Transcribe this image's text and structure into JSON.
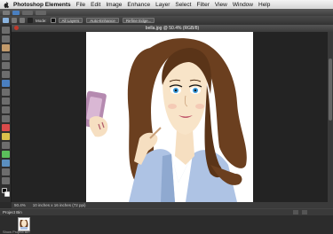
{
  "menubar": {
    "app_name": "Photoshop Elements",
    "items": [
      "File",
      "Edit",
      "Image",
      "Enhance",
      "Layer",
      "Select",
      "Filter",
      "View",
      "Window",
      "Help"
    ]
  },
  "options_bar": {
    "mode_label": "Mode:",
    "sample_label": "All Layers",
    "auto_enhance_label": "Auto-Enhance",
    "refine_edge_label": "Refine Edge..."
  },
  "document": {
    "tab_title": "bella.jpg @ 50.4% (RGB/8)",
    "zoom": "50.4%"
  },
  "status": {
    "zoom": "50.4%",
    "doc_info": "10 inches x 16 inches (72 ppi)"
  },
  "bin": {
    "title": "Project Bin",
    "footer": "Show Project Bin"
  },
  "colors": {
    "accent": "#1e88e5",
    "canvas": "#ffffff",
    "hair": "#6b3f1f",
    "phone": "#b58ab0"
  }
}
